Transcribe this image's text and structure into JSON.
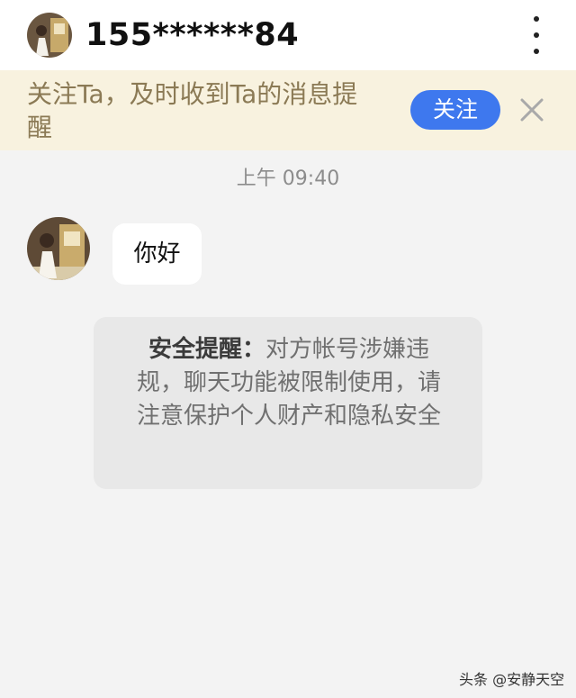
{
  "header": {
    "title": "155******84"
  },
  "banner": {
    "text": "关注Ta，及时收到Ta的消息提醒",
    "follow_label": "关注"
  },
  "chat": {
    "timestamp": "上午 09:40",
    "messages": [
      {
        "text": "你好"
      }
    ]
  },
  "notice": {
    "label": "安全提醒：",
    "body": "对方帐号涉嫌违规，聊天功能被限制使用，请注意保护个人财产和隐私安全"
  },
  "watermark": {
    "text": "头条 @安静天空"
  },
  "colors": {
    "accent": "#3e78ee",
    "banner_bg": "#f8f2df",
    "banner_text": "#8b7a55",
    "page_bg": "#f3f3f3"
  },
  "icons": [
    "avatar-photo",
    "more-vertical-icon",
    "close-icon"
  ]
}
